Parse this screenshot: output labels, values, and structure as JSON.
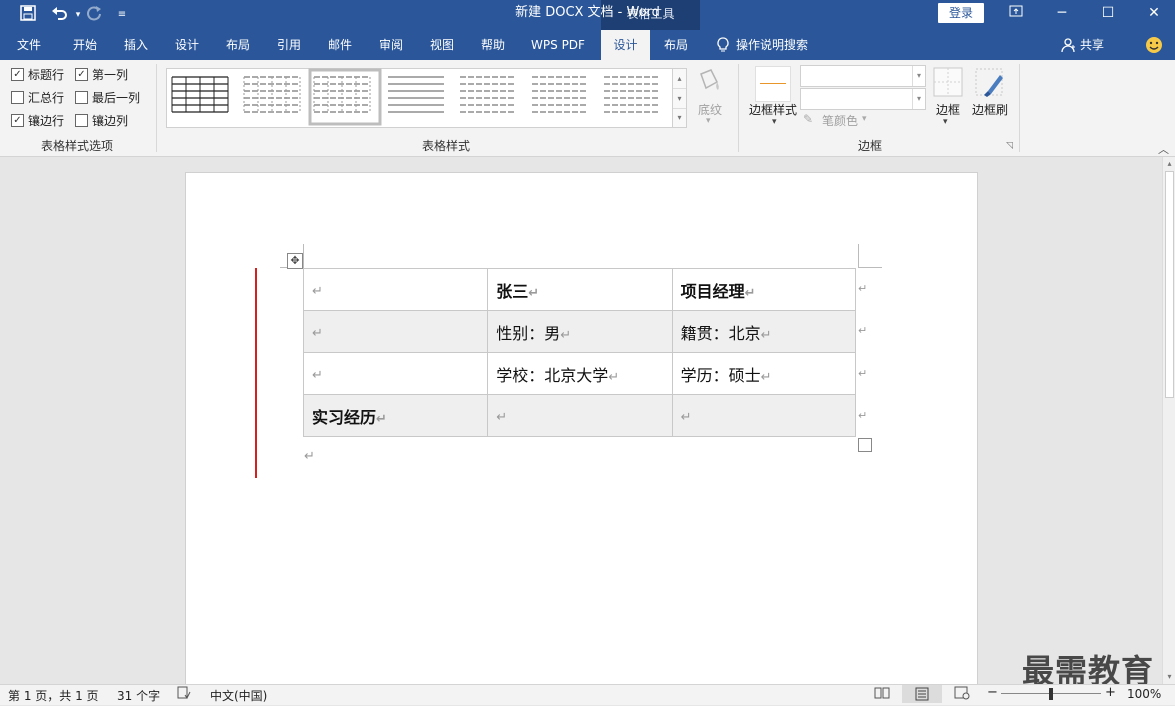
{
  "titlebar": {
    "doc_title": "新建 DOCX 文档  -  Word",
    "context_tab_header": "表格工具",
    "login_label": "登录",
    "icons": [
      "save-icon",
      "undo-icon",
      "redo-icon",
      "customize-qat-icon"
    ]
  },
  "tabs": {
    "items": [
      {
        "label": "文件"
      },
      {
        "label": "开始"
      },
      {
        "label": "插入"
      },
      {
        "label": "设计"
      },
      {
        "label": "布局"
      },
      {
        "label": "引用"
      },
      {
        "label": "邮件"
      },
      {
        "label": "审阅"
      },
      {
        "label": "视图"
      },
      {
        "label": "帮助"
      },
      {
        "label": "WPS PDF"
      },
      {
        "label": "设计"
      },
      {
        "label": "布局"
      }
    ],
    "active_index": 11,
    "tell_me": "操作说明搜索",
    "share": "共享"
  },
  "ribbon": {
    "options": {
      "header_row": "标题行",
      "first_column": "第一列",
      "total_row": "汇总行",
      "last_column": "最后一列",
      "banded_rows": "镶边行",
      "banded_columns": "镶边列",
      "checked": {
        "header_row": true,
        "first_column": true,
        "total_row": false,
        "last_column": false,
        "banded_rows": true,
        "banded_columns": false
      },
      "group_label": "表格样式选项"
    },
    "styles": {
      "group_label": "表格样式",
      "shading_label": "底纹"
    },
    "borders": {
      "border_styles_label": "边框样式",
      "pen_color_label": "笔颜色",
      "borders_label": "边框",
      "border_painter_label": "边框刷",
      "group_label": "边框"
    }
  },
  "document": {
    "table": [
      [
        "",
        "张三",
        "项目经理"
      ],
      [
        "",
        "性别：男",
        "籍贯：北京"
      ],
      [
        "",
        "学校：北京大学",
        "学历：硕士"
      ],
      [
        "实习经历",
        "",
        ""
      ]
    ],
    "bold_cells": [
      [
        0,
        1
      ],
      [
        0,
        2
      ],
      [
        3,
        0
      ]
    ]
  },
  "statusbar": {
    "page_info": "第 1 页，共 1 页",
    "word_count": "31 个字",
    "language": "中文(中国)",
    "zoom": "100%",
    "zoom_minus": "−",
    "zoom_plus": "+"
  },
  "watermark": "最需教育",
  "colors": {
    "brand": "#2b579a",
    "red_marker": "#d61f1f"
  }
}
